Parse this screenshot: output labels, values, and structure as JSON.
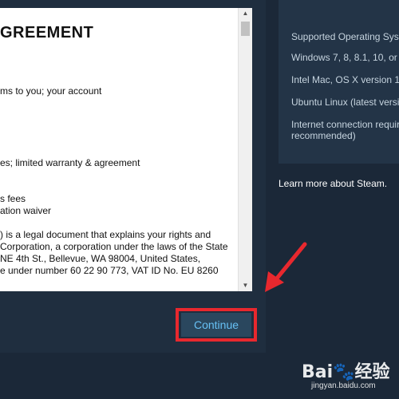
{
  "agreement": {
    "heading": "GREEMENT",
    "lines": [
      "ms to you; your account",
      "es; limited warranty & agreement",
      "s fees",
      "ation waiver",
      ") is a legal document that explains your rights and",
      "Corporation, a corporation under the laws of the State",
      "NE 4th St., Bellevue, WA 98004, United States,",
      "e under number 60 22 90 773, VAT ID No. EU 8260"
    ]
  },
  "scrollbar": {
    "up_arrow": "▲",
    "down_arrow": "▼"
  },
  "continue_button": {
    "label": "Continue",
    "highlight_color": "#e8282e"
  },
  "system_requirements": {
    "items": [
      "Supported Operating Sys",
      "Windows 7, 8, 8.1, 10, or",
      "Intel Mac, OS X version 1",
      "Ubuntu Linux (latest versi",
      "Internet connection requir",
      "recommended)"
    ]
  },
  "learn_more": "Learn more about Steam.",
  "watermark": {
    "logo": "Bai🐾经验",
    "url": "jingyan.baidu.com"
  },
  "colors": {
    "page_bg": "#1b2838",
    "button_text": "#67c1f5",
    "annotation": "#e8282e"
  }
}
